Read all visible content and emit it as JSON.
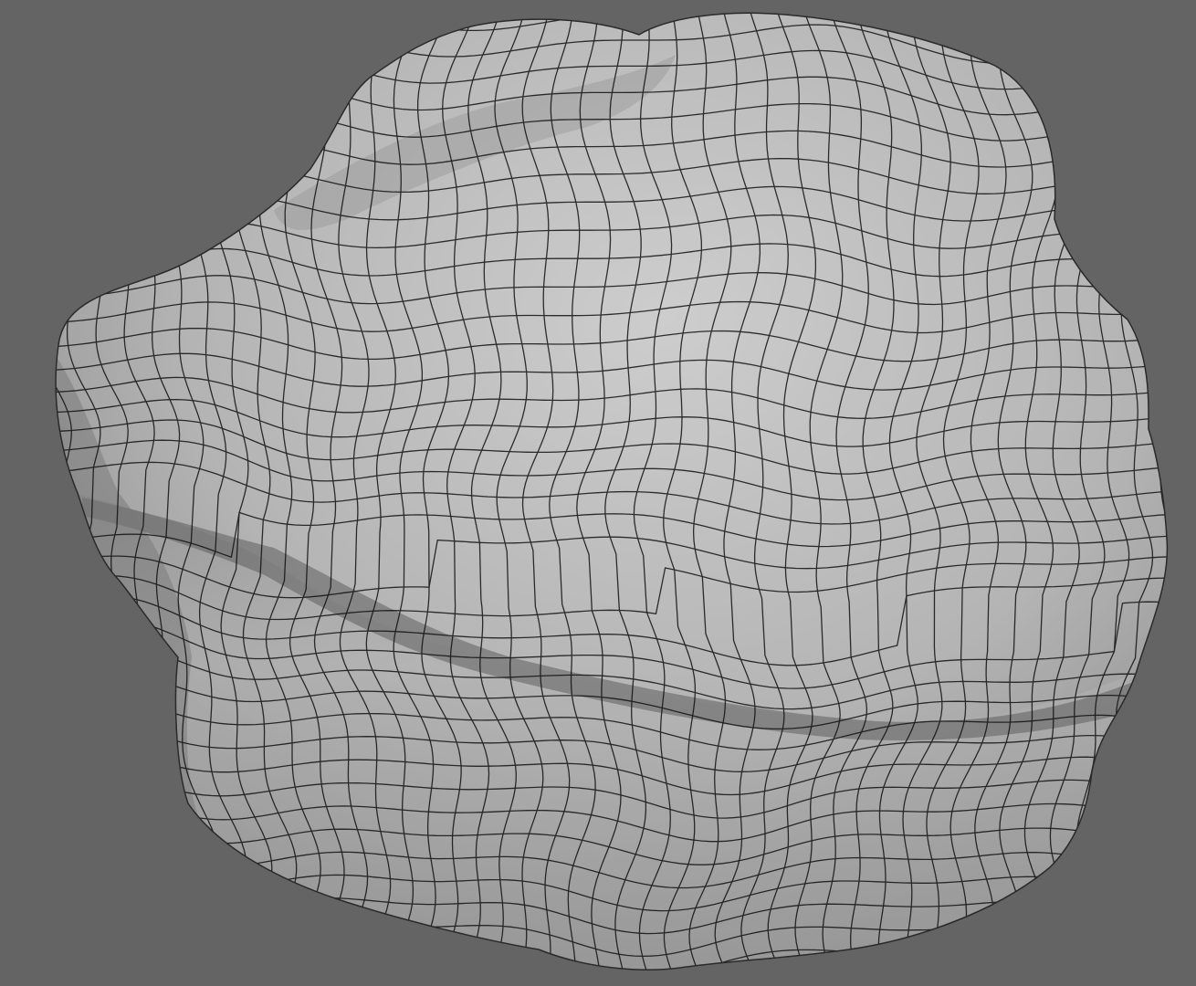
{
  "viewport": {
    "background_color": "#646464",
    "shading": "smooth-shaded-with-wireframe",
    "wireframe_color": "#111111",
    "surface_light_color": "#c9c9c9",
    "surface_mid_color": "#a9a9a9",
    "surface_dark_color": "#6f6f6f"
  },
  "model": {
    "object_type": "rock-mesh",
    "topology": "quad"
  }
}
